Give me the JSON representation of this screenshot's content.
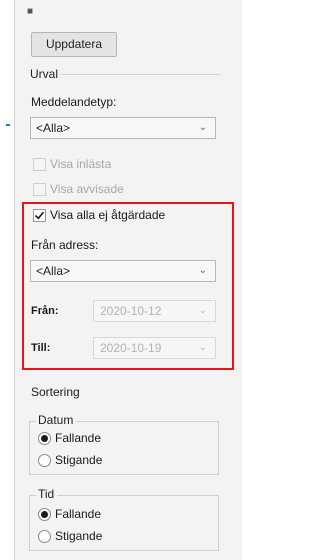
{
  "toolbar": {
    "update_label": "Uppdatera"
  },
  "urval": {
    "title": "Urval",
    "message_type_label": "Meddelandetyp:",
    "message_type_value": "<Alla>",
    "show_read_label": "Visa inlästa",
    "show_rejected_label": "Visa avvisade",
    "show_unhandled_label": "Visa alla ej åtgärdade",
    "from_address_label": "Från adress:",
    "from_address_value": "<Alla>",
    "from_label": "Från:",
    "from_value": "2020-10-12",
    "to_label": "Till:",
    "to_value": "2020-10-19"
  },
  "sort": {
    "title": "Sortering",
    "date_group": {
      "title": "Datum",
      "option_desc": "Fallande",
      "option_asc": "Stigande"
    },
    "time_group": {
      "title": "Tid",
      "option_desc": "Fallande",
      "option_asc": "Stigande"
    }
  },
  "colors": {
    "highlight": "#e6141b",
    "panel": "#f3f3f3"
  }
}
